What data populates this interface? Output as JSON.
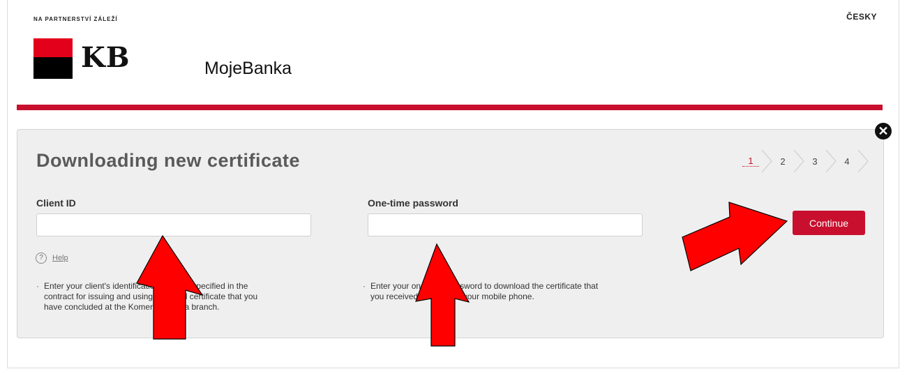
{
  "header": {
    "tagline": "NA PARTNERSTVÍ ZÁLEŽÍ",
    "language_link": "ČESKY",
    "logo_text": "KB",
    "app_name": "MojeBanka",
    "brand_color": "#c8102e"
  },
  "dialog": {
    "title": "Downloading new certificate",
    "close_icon": "close-icon",
    "steps": [
      "1",
      "2",
      "3",
      "4"
    ],
    "active_step": "1",
    "client_id": {
      "label": "Client ID",
      "value": "",
      "help_label": "Help",
      "hint": "Enter your client's identification number specified in the contract for issuing and using personal certificate that you have concluded at the Komerční banka branch."
    },
    "otp": {
      "label": "One-time password",
      "value": "",
      "hint": "Enter your one-time password to download the certificate that you received via SMS to your mobile phone."
    },
    "continue_label": "Continue"
  }
}
